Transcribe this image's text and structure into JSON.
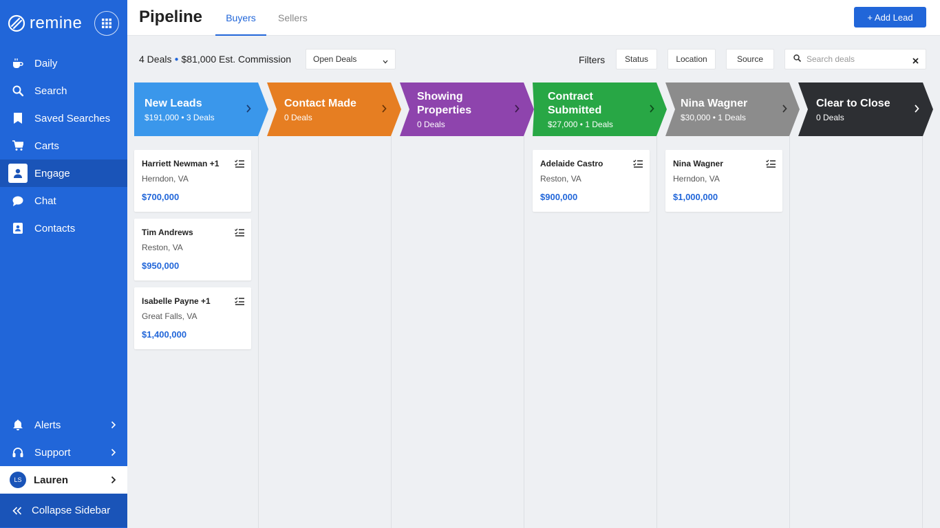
{
  "sidebar": {
    "brand": "remine",
    "nav": [
      {
        "label": "Daily",
        "icon": "coffee-icon"
      },
      {
        "label": "Search",
        "icon": "search-icon"
      },
      {
        "label": "Saved Searches",
        "icon": "bookmark-icon"
      },
      {
        "label": "Carts",
        "icon": "cart-icon"
      },
      {
        "label": "Engage",
        "icon": "person-icon",
        "active": true
      },
      {
        "label": "Chat",
        "icon": "chat-icon"
      },
      {
        "label": "Contacts",
        "icon": "contacts-icon"
      }
    ],
    "bottom": [
      {
        "label": "Alerts",
        "icon": "bell-icon"
      },
      {
        "label": "Support",
        "icon": "headset-icon"
      }
    ],
    "user": {
      "initials": "LS",
      "name": "Lauren"
    },
    "collapse_label": "Collapse Sidebar"
  },
  "header": {
    "title": "Pipeline",
    "tabs": [
      "Buyers",
      "Sellers"
    ],
    "add_lead": "+ Add Lead"
  },
  "toolbar": {
    "deals": "4 Deals",
    "commission": "$81,000 Est. Commission",
    "select_value": "Open Deals",
    "filters_label": "Filters",
    "filter_buttons": [
      "Status",
      "Location",
      "Source"
    ],
    "search_placeholder": "Search deals"
  },
  "stages": [
    {
      "name": "New Leads",
      "sub": "$191,000 • 3 Deals",
      "color": "#3a97eb"
    },
    {
      "name": "Contact Made",
      "sub": "0 Deals",
      "color": "#e67e22"
    },
    {
      "name": "Showing Properties",
      "sub": "0 Deals",
      "color": "#8e44ad"
    },
    {
      "name": "Contract Submitted",
      "sub": "$27,000  • 1 Deals",
      "color": "#28a745"
    },
    {
      "name": "Nina Wagner",
      "sub": "$30,000 • 1 Deals",
      "color": "#8c8c8c"
    },
    {
      "name": "Clear to Close",
      "sub": "0 Deals",
      "color": "#2d2f33"
    }
  ],
  "cards": [
    {
      "name": "Harriett Newman +1",
      "location": "Herndon, VA",
      "price": "$700,000"
    },
    {
      "name": "Tim Andrews",
      "location": "Reston, VA",
      "price": "$950,000"
    },
    {
      "name": "Isabelle Payne +1",
      "location": "Great Falls, VA",
      "price": "$1,400,000"
    },
    {
      "name": "Adelaide Castro",
      "location": "Reston, VA",
      "price": "$900,000"
    },
    {
      "name": "Nina Wagner",
      "location": "Herndon, VA",
      "price": "$1,000,000"
    }
  ]
}
